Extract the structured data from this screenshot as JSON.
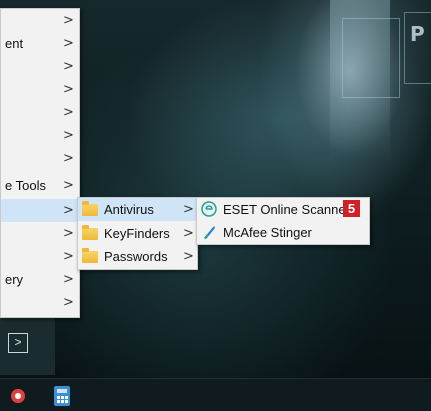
{
  "menu1": {
    "items": [
      {
        "label": ""
      },
      {
        "label": "ent"
      },
      {
        "label": ""
      },
      {
        "label": ""
      },
      {
        "label": ""
      },
      {
        "label": ""
      },
      {
        "label": ""
      },
      {
        "label": "e Tools"
      },
      {
        "label": ""
      },
      {
        "label": ""
      },
      {
        "label": ""
      },
      {
        "label": "ery"
      },
      {
        "label": ""
      }
    ]
  },
  "menu2": {
    "items": [
      {
        "label": "Antivirus"
      },
      {
        "label": "KeyFinders"
      },
      {
        "label": "Passwords"
      }
    ]
  },
  "menu3": {
    "items": [
      {
        "label": "ESET Online Scanner",
        "icon": "eset-icon"
      },
      {
        "label": "McAfee Stinger",
        "icon": "mcafee-stinger-icon"
      }
    ]
  },
  "callout": {
    "number": "5",
    "color": "#d0202a"
  },
  "desktop": {
    "logo_letter": "P"
  },
  "colors": {
    "highlight": "#cfe4f6",
    "menu_bg": "#f2f2f2",
    "folder": "#eeb93a"
  }
}
